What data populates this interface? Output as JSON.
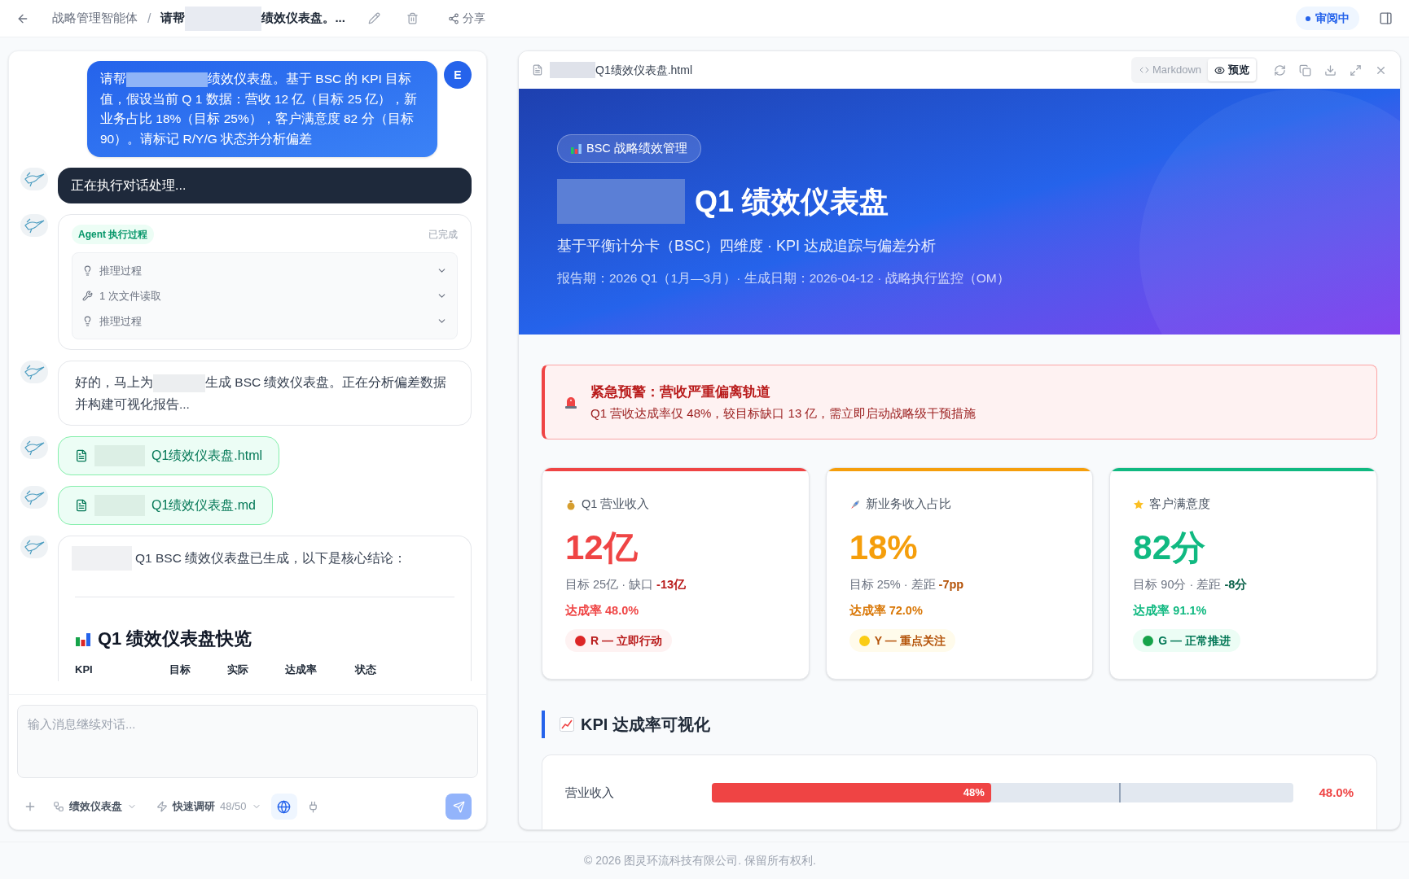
{
  "topbar": {
    "breadcrumb": "战略管理智能体",
    "separator": "/",
    "title_start": "请帮",
    "title_end": "绩效仪表盘。...",
    "share": "分享",
    "status": "审阅中"
  },
  "chat": {
    "messages": [
      {
        "kind": "user",
        "avatar": "E",
        "parts": [
          "请帮",
          "绩效仪表盘。基于 BSC 的 KPI 目标值，假设当前 Q 1 数据：营收 12 亿（目标 25 亿），新业务占比 18%（目标 25%），客户满意度 82 分（目标 90）。请标记 R/Y/G 状态并分析偏差"
        ]
      },
      {
        "kind": "status",
        "text": "正在执行对话处理..."
      },
      {
        "kind": "process",
        "badge": "Agent 执行过程",
        "state": "已完成",
        "steps": [
          {
            "kind": "reasoning",
            "label": "推理过程",
            "expanded": false
          },
          {
            "kind": "file",
            "label": "1 次文件读取",
            "expanded": false
          },
          {
            "kind": "reasoning",
            "label": "推理过程",
            "expanded": false
          }
        ]
      },
      {
        "kind": "reply",
        "parts": [
          "好的，马上为",
          "生成 BSC 绩效仪表盘。正在分析偏差数据并构建可视化报告..."
        ]
      },
      {
        "kind": "file",
        "name": "Q1绩效仪表盘.html"
      },
      {
        "kind": "file",
        "name": "Q1绩效仪表盘.md"
      },
      {
        "kind": "summary",
        "intro": "Q1 BSC 绩效仪表盘已生成，以下是核心结论：",
        "heading": "Q1 绩效仪表盘快览",
        "columns": [
          "KPI",
          "目标",
          "实际",
          "达成率",
          "状态"
        ]
      }
    ],
    "input": {
      "placeholder": "输入消息继续对话..."
    },
    "toolbar": {
      "skill": "绩效仪表盘",
      "mode": "快速调研",
      "quota": "48/50",
      "web_search": true
    }
  },
  "preview": {
    "filename": "Q1绩效仪表盘.html",
    "tabs": [
      {
        "label": "Markdown",
        "selected": false
      },
      {
        "label": "预览",
        "selected": true
      }
    ],
    "hero": {
      "tag": "BSC 战略绩效管理",
      "title": "Q1 绩效仪表盘",
      "subtitle": "基于平衡计分卡（BSC）四维度 · KPI 达成追踪与偏差分析",
      "meta": "报告期：2026 Q1（1月—3月）· 生成日期：2026-04-12 · 战略执行监控（OM）"
    },
    "alert": {
      "title": "紧急预警：营收严重偏离轨道",
      "text": "Q1 营收达成率仅 48%，较目标缺口 13 亿，需立即启动战略级干预措施"
    },
    "kpis": [
      {
        "kind": "danger",
        "label": "Q1 营业收入",
        "value": "12亿",
        "target": "目标 25亿 · 缺口",
        "gap": "-13亿",
        "rate": "达成率 48.0%",
        "badge": "R — 立即行动"
      },
      {
        "kind": "warning",
        "label": "新业务收入占比",
        "value": "18%",
        "target": "目标 25% · 差距",
        "gap": "-7pp",
        "rate": "达成率 72.0%",
        "badge": "Y — 重点关注"
      },
      {
        "kind": "success",
        "label": "客户满意度",
        "value": "82分",
        "target": "目标 90分 · 差距",
        "gap": "-8分",
        "rate": "达成率 91.1%",
        "badge": "G — 正常推进"
      }
    ],
    "chart_section": {
      "title": "KPI 达成率可视化",
      "rows": [
        {
          "label": "营业收入",
          "level": 0.48,
          "bar_text": "48%",
          "reading": "48.0%",
          "kind": "danger",
          "target": {
            "level": 0.7
          }
        }
      ]
    }
  },
  "footer": "© 2026 图灵环流科技有限公司. 保留所有权利."
}
